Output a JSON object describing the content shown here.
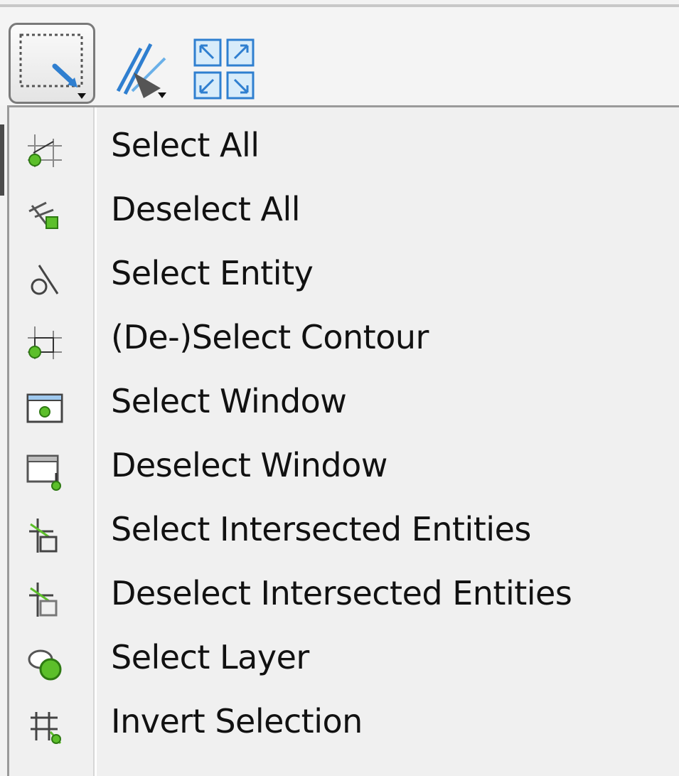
{
  "toolbar": {
    "buttons": [
      {
        "name": "select-tool",
        "icon": "selection-rectangle-icon",
        "has_dropdown": true,
        "active": true
      },
      {
        "name": "pan-tool",
        "icon": "pan-lasso-icon",
        "has_dropdown": true
      },
      {
        "name": "zoom-fit-tool",
        "icon": "zoom-fit-icon",
        "has_dropdown": false
      }
    ]
  },
  "menu": {
    "items": [
      {
        "label": "Select All",
        "icon": "select-all-icon"
      },
      {
        "label": "Deselect All",
        "icon": "deselect-all-icon"
      },
      {
        "label": "Select Entity",
        "icon": "select-entity-icon"
      },
      {
        "label": "(De-)Select Contour",
        "icon": "select-contour-icon"
      },
      {
        "label": "Select Window",
        "icon": "select-window-icon"
      },
      {
        "label": "Deselect Window",
        "icon": "deselect-window-icon"
      },
      {
        "label": "Select Intersected Entities",
        "icon": "select-intersected-icon"
      },
      {
        "label": "Deselect Intersected Entities",
        "icon": "deselect-intersected-icon"
      },
      {
        "label": "Select Layer",
        "icon": "select-layer-icon"
      },
      {
        "label": "Invert Selection",
        "icon": "invert-selection-icon"
      }
    ]
  },
  "colors": {
    "menu_bg": "#f0f0f0",
    "text": "#111111",
    "icon_green": "#5cbf2a",
    "icon_blue": "#2f7fd0"
  }
}
